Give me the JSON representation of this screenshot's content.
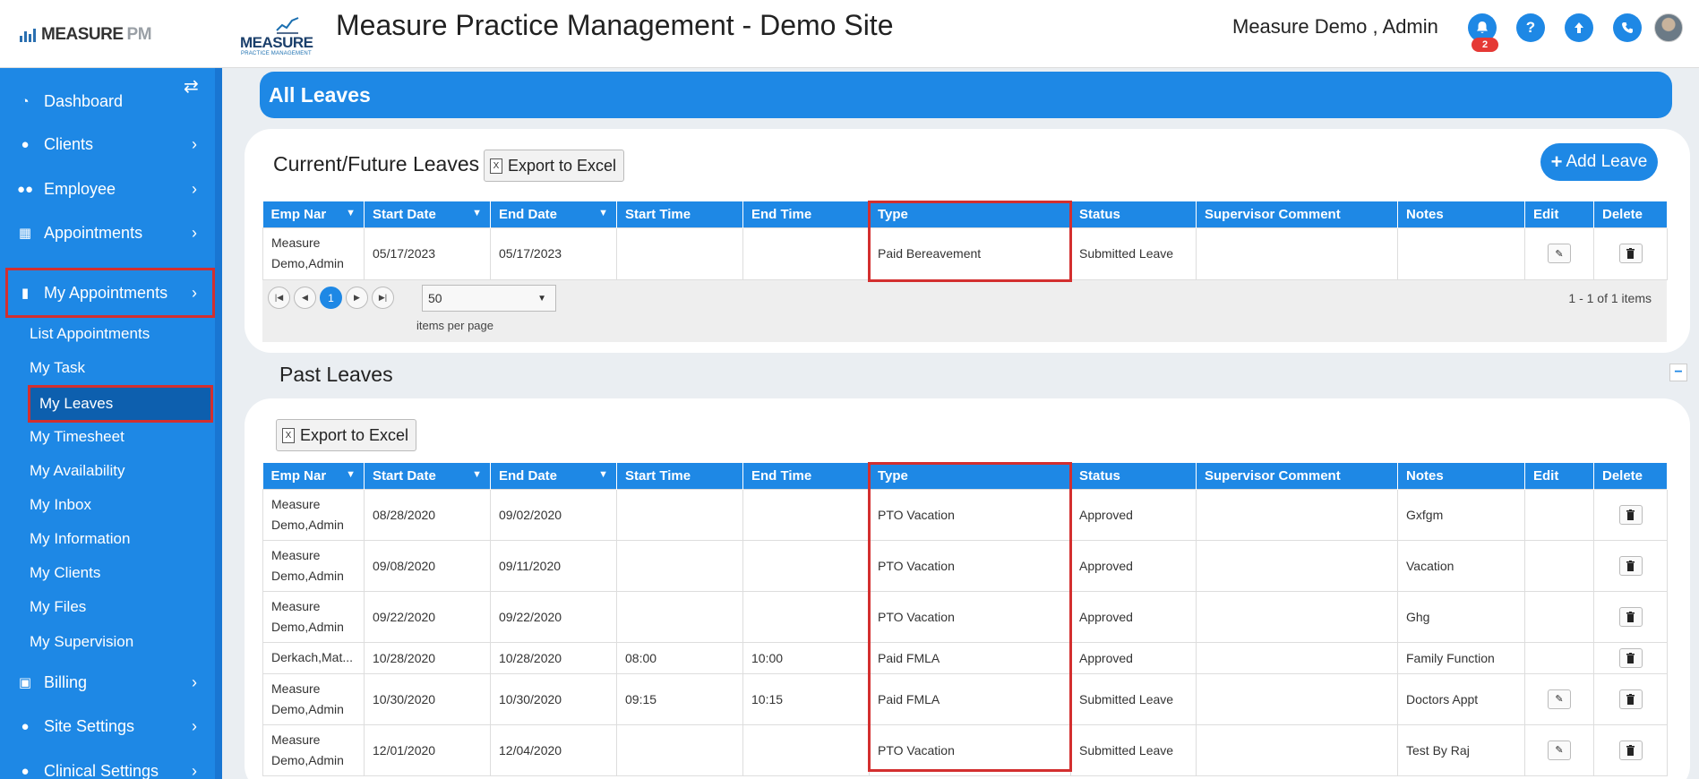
{
  "header": {
    "brand_left": "MEASURE",
    "brand_left_suffix": "PM",
    "brand_mid": "MEASURE",
    "brand_mid_sub": "PRACTICE MANAGEMENT",
    "site_title": "Measure Practice Management - Demo Site",
    "user_name": "Measure Demo , Admin",
    "notification_count": "2",
    "icons": [
      "bell-icon",
      "help-icon",
      "upload-icon",
      "phone-icon"
    ]
  },
  "sidebar": {
    "items": [
      {
        "label": "Dashboard",
        "icon": "dashboard-icon",
        "chevron": false
      },
      {
        "label": "Clients",
        "icon": "user-icon",
        "chevron": true
      },
      {
        "label": "Employee",
        "icon": "users-icon",
        "chevron": true
      },
      {
        "label": "Appointments",
        "icon": "calendar-icon",
        "chevron": true
      },
      {
        "label": "My Appointments",
        "icon": "building-icon",
        "chevron": true
      },
      {
        "label": "Billing",
        "icon": "money-icon",
        "chevron": true
      },
      {
        "label": "Site Settings",
        "icon": "user-icon",
        "chevron": true
      },
      {
        "label": "Clinical Settings",
        "icon": "user-icon",
        "chevron": true
      }
    ],
    "sub_items": [
      "List Appointments",
      "My Task",
      "My Leaves",
      "My Timesheet",
      "My Availability",
      "My Inbox",
      "My Information",
      "My Clients",
      "My Files",
      "My Supervision"
    ]
  },
  "page": {
    "title": "All Leaves",
    "current_title": "Current/Future Leaves",
    "past_title": "Past Leaves",
    "export_label": "Export to Excel",
    "add_label": "Add Leave",
    "collapse_label": "−"
  },
  "columns": [
    "Emp Nar",
    "Start Date",
    "End Date",
    "Start Time",
    "End Time",
    "Type",
    "Status",
    "Supervisor Comment",
    "Notes",
    "Edit",
    "Delete"
  ],
  "current_rows": [
    {
      "emp": "Measure Demo,Admin",
      "start_date": "05/17/2023",
      "end_date": "05/17/2023",
      "start_time": "",
      "end_time": "",
      "type": "Paid Bereavement",
      "status": "Submitted Leave",
      "comment": "",
      "notes": "",
      "edit": true
    }
  ],
  "pager": {
    "current_page": "1",
    "page_size": "50",
    "page_size_label": "items per page",
    "info": "1 - 1 of 1 items"
  },
  "past_rows": [
    {
      "emp": "Measure Demo,Admin",
      "start_date": "08/28/2020",
      "end_date": "09/02/2020",
      "start_time": "",
      "end_time": "",
      "type": "PTO Vacation",
      "status": "Approved",
      "comment": "",
      "notes": "Gxfgm",
      "edit": false
    },
    {
      "emp": "Measure Demo,Admin",
      "start_date": "09/08/2020",
      "end_date": "09/11/2020",
      "start_time": "",
      "end_time": "",
      "type": "PTO Vacation",
      "status": "Approved",
      "comment": "",
      "notes": "Vacation",
      "edit": false
    },
    {
      "emp": "Measure Demo,Admin",
      "start_date": "09/22/2020",
      "end_date": "09/22/2020",
      "start_time": "",
      "end_time": "",
      "type": "PTO Vacation",
      "status": "Approved",
      "comment": "",
      "notes": "Ghg",
      "edit": false
    },
    {
      "emp": "Derkach,Mat...",
      "start_date": "10/28/2020",
      "end_date": "10/28/2020",
      "start_time": "08:00",
      "end_time": "10:00",
      "type": "Paid FMLA",
      "status": "Approved",
      "comment": "",
      "notes": "Family Function",
      "edit": false
    },
    {
      "emp": "Measure Demo,Admin",
      "start_date": "10/30/2020",
      "end_date": "10/30/2020",
      "start_time": "09:15",
      "end_time": "10:15",
      "type": "Paid FMLA",
      "status": "Submitted Leave",
      "comment": "",
      "notes": "Doctors Appt",
      "edit": true
    },
    {
      "emp": "Measure Demo,Admin",
      "start_date": "12/01/2020",
      "end_date": "12/04/2020",
      "start_time": "",
      "end_time": "",
      "type": "PTO Vacation",
      "status": "Submitted Leave",
      "comment": "",
      "notes": "Test By Raj",
      "edit": true
    }
  ]
}
